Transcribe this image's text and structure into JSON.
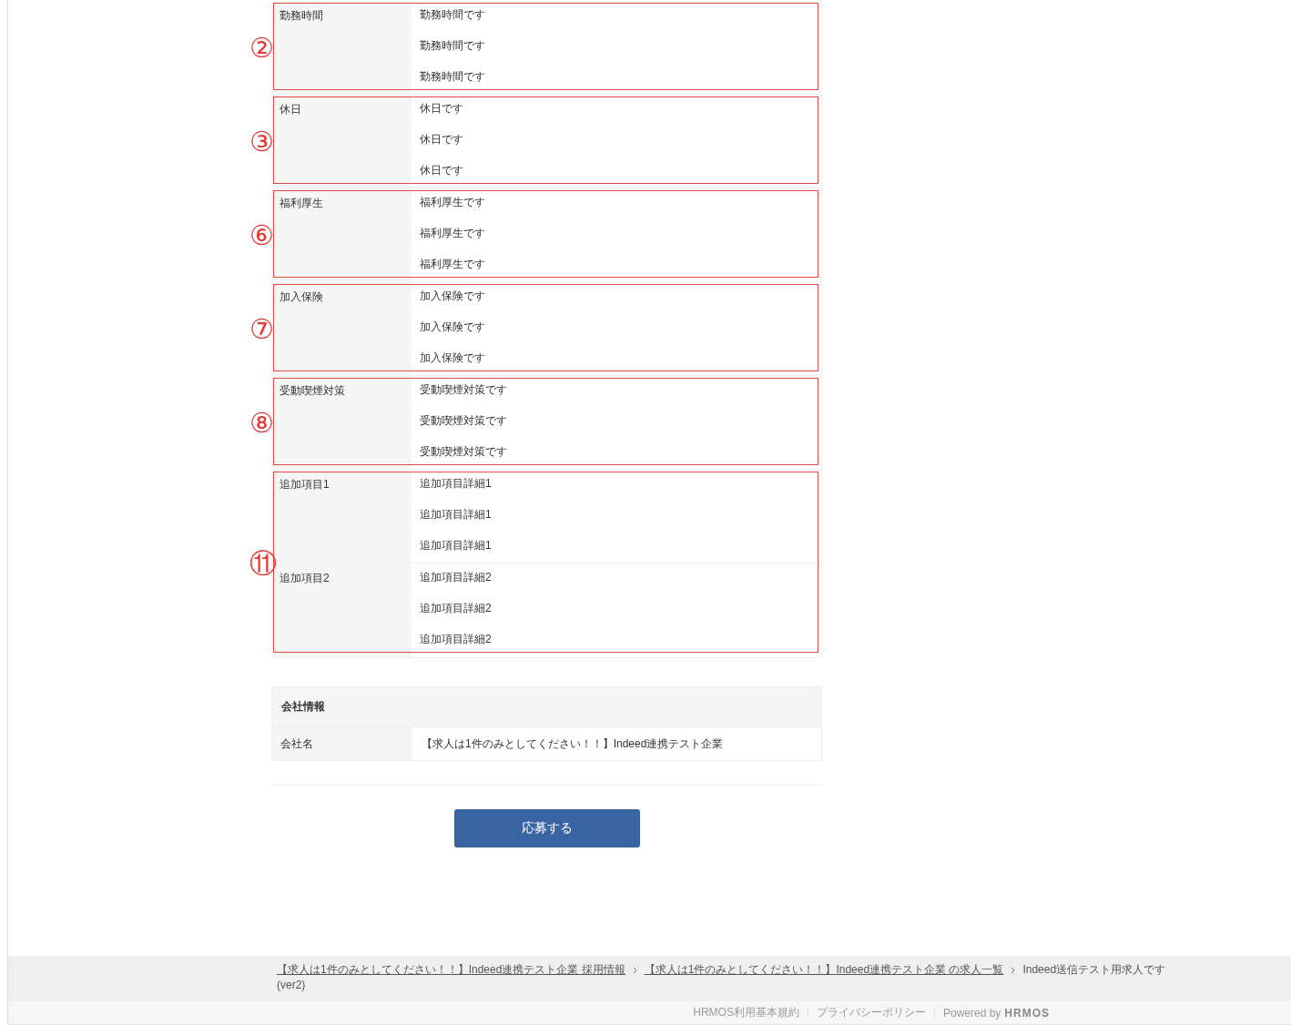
{
  "job_details": {
    "groups": [
      {
        "marker": "②",
        "rows": [
          {
            "label": "勤務時間",
            "lines": [
              "勤務時間です",
              "勤務時間です",
              "勤務時間です"
            ]
          }
        ]
      },
      {
        "marker": "③",
        "rows": [
          {
            "label": "休日",
            "lines": [
              "休日です",
              "休日です",
              "休日です"
            ]
          }
        ]
      },
      {
        "marker": "⑥",
        "rows": [
          {
            "label": "福利厚生",
            "lines": [
              "福利厚生です",
              "福利厚生です",
              "福利厚生です"
            ]
          }
        ]
      },
      {
        "marker": "⑦",
        "rows": [
          {
            "label": "加入保険",
            "lines": [
              "加入保険です",
              "加入保険です",
              "加入保険です"
            ]
          }
        ]
      },
      {
        "marker": "⑧",
        "rows": [
          {
            "label": "受動喫煙対策",
            "lines": [
              "受動喫煙対策です",
              "受動喫煙対策です",
              "受動喫煙対策です"
            ]
          }
        ]
      },
      {
        "marker": "⑪",
        "rows": [
          {
            "label": "追加項目1",
            "lines": [
              "追加項目詳細1",
              "追加項目詳細1",
              "追加項目詳細1"
            ]
          },
          {
            "label": "追加項目2",
            "lines": [
              "追加項目詳細2",
              "追加項目詳細2",
              "追加項目詳細2"
            ]
          }
        ]
      }
    ]
  },
  "company_info": {
    "heading": "会社情報",
    "rows": [
      {
        "label": "会社名",
        "value": "【求人は1件のみとしてください！！】Indeed連携テスト企業"
      }
    ]
  },
  "apply_button": {
    "label": "応募する"
  },
  "breadcrumbs": [
    {
      "lines": [
        "【求人は1件のみとしてください！！】Indeed連携テスト企業 採用情報"
      ],
      "link": true
    },
    {
      "lines": [
        "【求人は1件のみとしてください！！】Indeed連携テスト企業 の求人一覧"
      ],
      "link": true
    },
    {
      "lines": [
        "Indeed送信テスト用求人です",
        "(ver2)"
      ],
      "link": false
    }
  ],
  "footer": {
    "links": [
      "HRMOS利用基本規約",
      "プライバシーポリシー"
    ],
    "powered_by": "Powered by",
    "logo": "HRMOS"
  }
}
